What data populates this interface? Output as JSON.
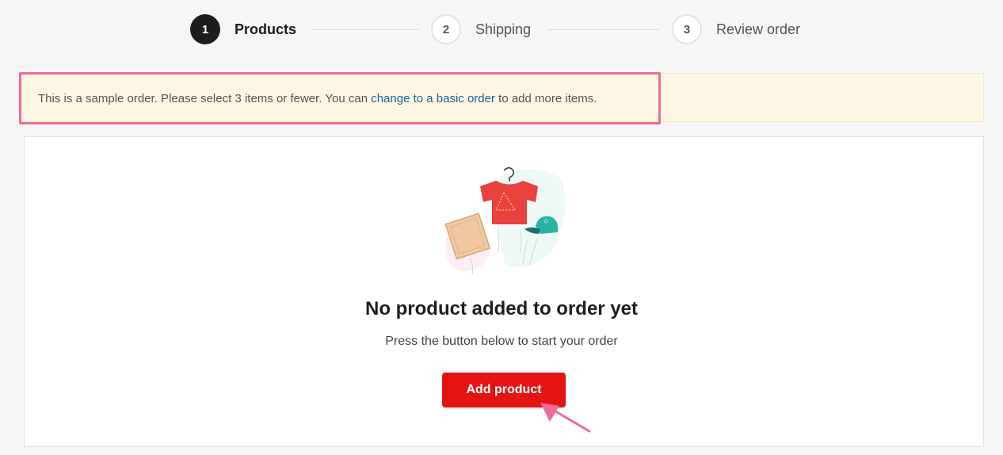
{
  "stepper": {
    "steps": [
      {
        "number": "1",
        "label": "Products",
        "state": "active"
      },
      {
        "number": "2",
        "label": "Shipping",
        "state": "inactive"
      },
      {
        "number": "3",
        "label": "Review order",
        "state": "inactive"
      }
    ]
  },
  "notice": {
    "text_before": "This is a sample order. Please select 3 items or fewer. You can ",
    "link_text": "change to a basic order",
    "text_after": " to add more items."
  },
  "empty_state": {
    "illustration_icon": "products-illustration",
    "title": "No product added to order yet",
    "subtitle": "Press the button below to start your order",
    "button_label": "Add product"
  },
  "colors": {
    "primary_button": "#e31412",
    "link": "#1a61a6",
    "notice_background": "#fdf6e3",
    "highlight_annotation": "#ee6b9a"
  }
}
